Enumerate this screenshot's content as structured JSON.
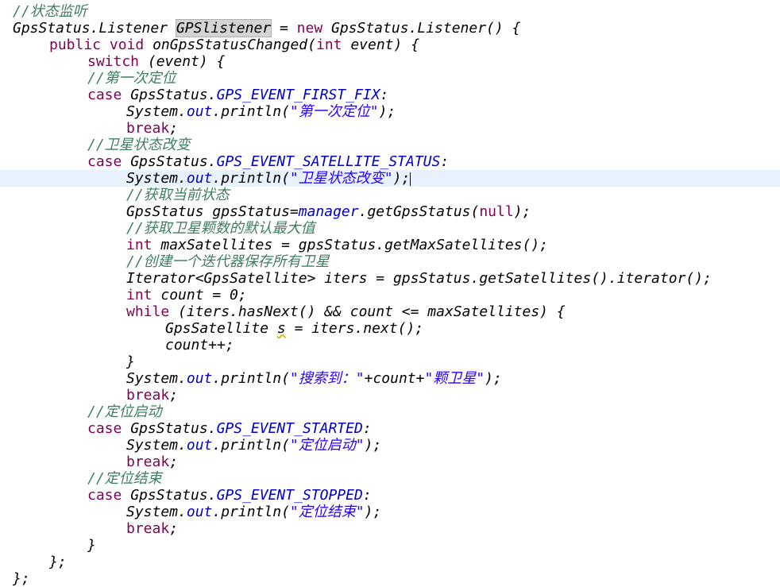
{
  "code": {
    "l01": "//状态监听",
    "l02a": "GpsStatus.Listener ",
    "l02b": "GPSlistener",
    "l02c": " = ",
    "l02d": "new",
    "l02e": " GpsStatus.Listener() {",
    "l03a": "public",
    "l03b": "void",
    "l03c": " onGpsStatusChanged(",
    "l03d": "int",
    "l03e": " event) {",
    "l04a": "switch",
    "l04b": " (event) {",
    "l05": "//第一次定位",
    "l06a": "case",
    "l06b": " GpsStatus.",
    "l06c": "GPS_EVENT_FIRST_FIX",
    "l06d": ":",
    "l07a": "System.",
    "l07b": "out",
    "l07c": ".println(",
    "l07d": "\"第一次定位\"",
    "l07e": ");",
    "l08a": "break",
    "l08b": ";",
    "l09": "//卫星状态改变",
    "l10a": "case",
    "l10b": " GpsStatus.",
    "l10c": "GPS_EVENT_SATELLITE_STATUS",
    "l10d": ":",
    "l11a": "System.",
    "l11b": "out",
    "l11c": ".println(",
    "l11d": "\"卫星状态改变\"",
    "l11e": ");",
    "l12": "//获取当前状态",
    "l13a": "GpsStatus gpsStatus=",
    "l13b": "manager",
    "l13c": ".getGpsStatus(",
    "l13d": "null",
    "l13e": ");",
    "l14": "//获取卫星颗数的默认最大值",
    "l15a": "int",
    "l15b": " maxSatellites = gpsStatus.getMaxSatellites();",
    "l16": "//创建一个迭代器保存所有卫星",
    "l17": "Iterator<GpsSatellite> iters = gpsStatus.getSatellites().iterator();",
    "l18a": "int",
    "l18b": " count = 0;",
    "l19a": "while",
    "l19b": " (iters.hasNext() && count <= maxSatellites) {",
    "l20a": "GpsSatellite ",
    "l20b": "s",
    "l20c": " = iters.next();",
    "l21": "count++;",
    "l22": "}",
    "l23a": "System.",
    "l23b": "out",
    "l23c": ".println(",
    "l23d": "\"搜索到：\"",
    "l23e": "+count+",
    "l23f": "\"颗卫星\"",
    "l23g": ");",
    "l24a": "break",
    "l24b": ";",
    "l25": "//定位启动",
    "l26a": "case",
    "l26b": " GpsStatus.",
    "l26c": "GPS_EVENT_STARTED",
    "l26d": ":",
    "l27a": "System.",
    "l27b": "out",
    "l27c": ".println(",
    "l27d": "\"定位启动\"",
    "l27e": ");",
    "l28a": "break",
    "l28b": ";",
    "l29": "//定位结束",
    "l30a": "case",
    "l30b": " GpsStatus.",
    "l30c": "GPS_EVENT_STOPPED",
    "l30d": ":",
    "l31a": "System.",
    "l31b": "out",
    "l31c": ".println(",
    "l31d": "\"定位结束\"",
    "l31e": ");",
    "l32a": "break",
    "l32b": ";",
    "l33": "}",
    "l34": "};",
    "l35": "};"
  },
  "colors": {
    "keyword": "#7f0055",
    "comment": "#3f7f5f",
    "string": "#2a00ff",
    "field": "#0000c0",
    "current_line": "#e8f2fe"
  }
}
